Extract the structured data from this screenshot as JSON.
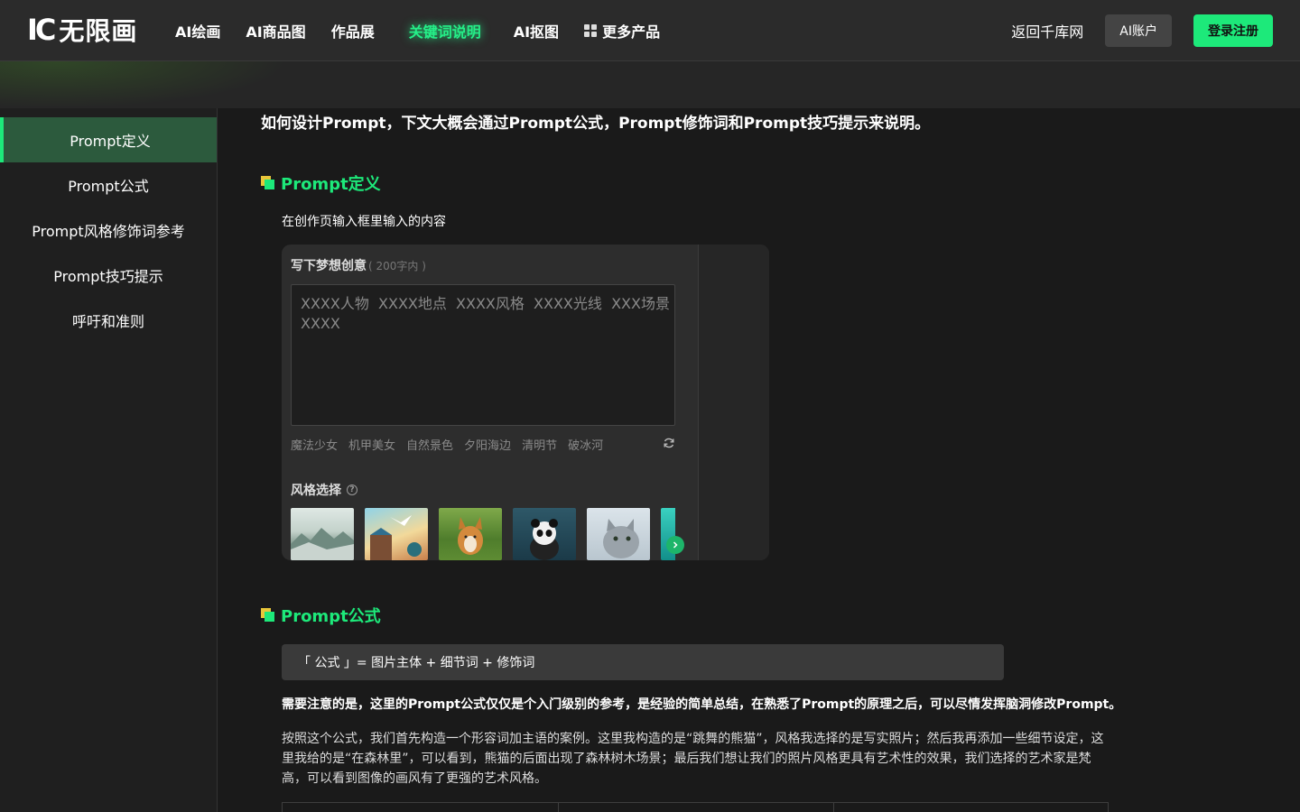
{
  "header": {
    "logo_text": "无限画",
    "nav": [
      "AI绘画",
      "AI商品图",
      "作品展",
      "关键词说明",
      "AI抠图",
      "更多产品"
    ],
    "active_nav": "关键词说明",
    "back_link": "返回千库网",
    "account_button": "AI账户",
    "login_button": "登录注册"
  },
  "sidebar": {
    "items": [
      "Prompt定义",
      "Prompt公式",
      "Prompt风格修饰词参考",
      "Prompt技巧提示",
      "呼吁和准则"
    ],
    "active_index": 0
  },
  "content": {
    "intro": "如何设计Prompt，下文大概会通过Prompt公式，Prompt修饰词和Prompt技巧提示来说明。",
    "section1": {
      "title": "Prompt定义",
      "desc": "在创作页输入框里输入的内容"
    },
    "panel": {
      "label": "写下梦想创意",
      "limit": "( 200字内 )",
      "textarea_line1": "XXXX人物  XXXX地点  XXXX风格  XXXX光线  XXX场景",
      "textarea_line2": "XXXX",
      "tags": [
        "魔法少女",
        "机甲美女",
        "自然景色",
        "夕阳海边",
        "清明节",
        "破冰河"
      ],
      "style_label": "风格选择",
      "help_mark": "?"
    },
    "section2": {
      "title": "Prompt公式",
      "formula": "「 公式 」= 图片主体 + 细节词 + 修饰词",
      "note": "需要注意的是，这里的Prompt公式仅仅是个入门级别的参考，是经验的简单总结，在熟悉了Prompt的原理之后，可以尽情发挥脑洞修改Prompt。",
      "paragraph": "按照这个公式，我们首先构造一个形容词加主语的案例。这里我构造的是“跳舞的熊猫”，风格我选择的是写实照片；然后我再添加一些细节设定，这里我给的是“在森林里”，可以看到，熊猫的后面出现了森林树木场景；最后我们想让我们的照片风格更具有艺术性的效果，我们选择的艺术家是梵高，可以看到图像的画风有了更强的艺术风格。"
    }
  },
  "colors": {
    "accent": "#1de97a",
    "background": "#1a1a1a",
    "header": "#2b2b2b",
    "sidebar_active": "#2c5a3d"
  }
}
